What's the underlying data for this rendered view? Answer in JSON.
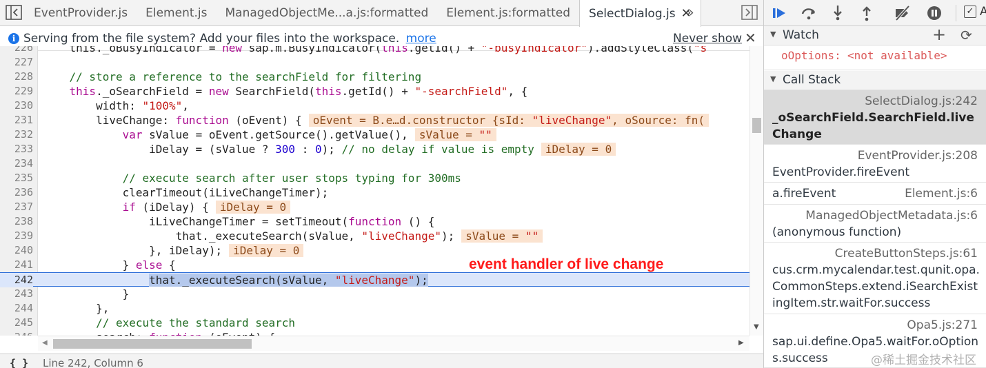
{
  "tabs": [
    {
      "label": "EventProvider.js"
    },
    {
      "label": "Element.js"
    },
    {
      "label": "ManagedObjectMe...a.js:formatted"
    },
    {
      "label": "Element.js:formatted"
    },
    {
      "label": "SelectDialog.js",
      "active": true
    }
  ],
  "tab_close_glyph": "✕",
  "tab_overflow": "»",
  "infobar": {
    "message": "Serving from the file system? Add your files into the workspace.",
    "more_link": "more",
    "never_show": "Never show",
    "close": "✕"
  },
  "editor": {
    "current_line": 242,
    "lines": [
      {
        "n": "226",
        "segments": [
          [
            "",
            "    this._oBusyIndicator = "
          ],
          [
            "kw",
            "new"
          ],
          [
            "",
            " sap.m.BusyIndicator("
          ],
          [
            "kw",
            "this"
          ],
          [
            "",
            ".getId() + "
          ],
          [
            "str",
            "\"-busyIndicator\""
          ],
          [
            "",
            ").addStyleClass("
          ],
          [
            "str",
            "\"s"
          ]
        ]
      },
      {
        "n": "227",
        "segments": [
          [
            "",
            ""
          ]
        ]
      },
      {
        "n": "228",
        "segments": [
          [
            "cm",
            "    // store a reference to the searchField for filtering"
          ]
        ]
      },
      {
        "n": "229",
        "segments": [
          [
            "",
            "    "
          ],
          [
            "kw",
            "this"
          ],
          [
            "",
            "._oSearchField = "
          ],
          [
            "kw",
            "new"
          ],
          [
            "",
            " SearchField("
          ],
          [
            "kw",
            "this"
          ],
          [
            "",
            ".getId() + "
          ],
          [
            "str",
            "\"-searchField\""
          ],
          [
            "",
            ", {"
          ]
        ]
      },
      {
        "n": "230",
        "segments": [
          [
            "",
            "        width: "
          ],
          [
            "str",
            "\"100%\""
          ],
          [
            "",
            ","
          ]
        ]
      },
      {
        "n": "231",
        "segments": [
          [
            "",
            "        liveChange: "
          ],
          [
            "kw",
            "function"
          ],
          [
            "",
            " (oEvent) {"
          ]
        ],
        "inline": [
          [
            "",
            "oEvent = B.e…d.constructor {sId: "
          ],
          [
            "str",
            "\"liveChange\""
          ],
          [
            "",
            ", oSource: fn("
          ]
        ]
      },
      {
        "n": "232",
        "segments": [
          [
            "",
            "            "
          ],
          [
            "kw",
            "var"
          ],
          [
            "",
            " sValue = oEvent.getSource().getValue(),"
          ]
        ],
        "inline": [
          [
            "",
            "sValue = "
          ],
          [
            "str",
            "\"\""
          ]
        ]
      },
      {
        "n": "233",
        "segments": [
          [
            "",
            "                iDelay = (sValue ? "
          ],
          [
            "num",
            "300"
          ],
          [
            "",
            " : "
          ],
          [
            "num",
            "0"
          ],
          [
            "",
            "); "
          ],
          [
            "cm",
            "// no delay if value is empty"
          ]
        ],
        "inline": [
          [
            "",
            "iDelay = 0"
          ]
        ]
      },
      {
        "n": "234",
        "segments": [
          [
            "",
            ""
          ]
        ]
      },
      {
        "n": "235",
        "segments": [
          [
            "cm",
            "            // execute search after user stops typing for 300ms"
          ]
        ]
      },
      {
        "n": "236",
        "segments": [
          [
            "",
            "            clearTimeout(iLiveChangeTimer);"
          ]
        ]
      },
      {
        "n": "237",
        "segments": [
          [
            "",
            "            "
          ],
          [
            "kw",
            "if"
          ],
          [
            "",
            " (iDelay) {"
          ]
        ],
        "inline": [
          [
            "",
            "iDelay = 0"
          ]
        ]
      },
      {
        "n": "238",
        "segments": [
          [
            "",
            "                iLiveChangeTimer = setTimeout("
          ],
          [
            "kw",
            "function"
          ],
          [
            "",
            " () {"
          ]
        ]
      },
      {
        "n": "239",
        "segments": [
          [
            "",
            "                    that._executeSearch(sValue, "
          ],
          [
            "str",
            "\"liveChange\""
          ],
          [
            "",
            ");"
          ]
        ],
        "inline": [
          [
            "",
            "sValue = "
          ],
          [
            "str",
            "\"\""
          ]
        ]
      },
      {
        "n": "240",
        "segments": [
          [
            "",
            "                }, iDelay);"
          ]
        ],
        "inline": [
          [
            "",
            "iDelay = 0"
          ]
        ]
      },
      {
        "n": "241",
        "segments": [
          [
            "",
            "            } "
          ],
          [
            "kw",
            "else"
          ],
          [
            "",
            " {"
          ]
        ]
      },
      {
        "n": "242",
        "segments": [
          [
            "",
            "                "
          ],
          [
            "sel",
            "that._executeSearch(sValue, "
          ],
          [
            "selstr",
            "\"liveChange\""
          ],
          [
            "sel",
            ");"
          ]
        ]
      },
      {
        "n": "243",
        "segments": [
          [
            "",
            "            }"
          ]
        ]
      },
      {
        "n": "244",
        "segments": [
          [
            "",
            "        },"
          ]
        ]
      },
      {
        "n": "245",
        "segments": [
          [
            "cm",
            "        // execute the standard search"
          ]
        ]
      },
      {
        "n": "246",
        "segments": [
          [
            "",
            "        search: "
          ],
          [
            "kw",
            "function"
          ],
          [
            "",
            " (oEvent) {"
          ]
        ]
      }
    ]
  },
  "annotation": "event handler of live change",
  "statusbar": {
    "pretty_print": "{ }",
    "cursor": "Line 242, Column 6"
  },
  "debugger": {
    "async_checkbox": "✓",
    "async_label": "A",
    "watch": {
      "title": "Watch",
      "add": "+",
      "refresh": "⟳",
      "entries": [
        {
          "name": "oOptions:",
          "value": "<not available>"
        }
      ]
    },
    "callstack": {
      "title": "Call Stack",
      "frames": [
        {
          "location": "SelectDialog.js:242",
          "function": "_oSearchField.SearchField.liveChange",
          "selected": true
        },
        {
          "location": "EventProvider.js:208",
          "function": "EventProvider.fireEvent"
        },
        {
          "location": "Element.js:6",
          "function": "a.fireEvent",
          "inline": true
        },
        {
          "location": "ManagedObjectMetadata.js:6",
          "function": "(anonymous function)"
        },
        {
          "location": "CreateButtonSteps.js:61",
          "function": "cus.crm.mycalendar.test.qunit.opa.CommonSteps.extend.iSearchExistingItem.str.waitFor.success"
        },
        {
          "location": "Opa5.js:271",
          "function": "sap.ui.define.Opa5.waitFor.oOptions.success"
        }
      ]
    }
  },
  "watermark": "@稀土掘金技术社区"
}
